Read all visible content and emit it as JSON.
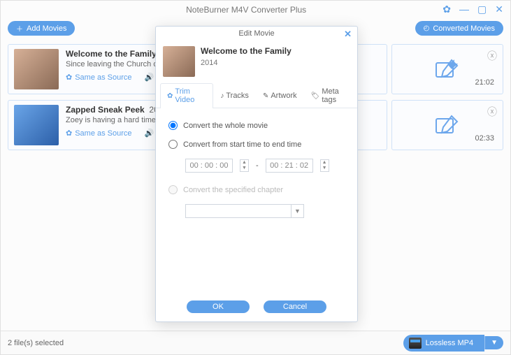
{
  "title": "NoteBurner M4V Converter Plus",
  "toolbar": {
    "add_label": "Add Movies",
    "converted_label": "Converted Movies"
  },
  "movies": [
    {
      "title": "Welcome to the Family",
      "desc": "Since leaving the Church of Sc",
      "source_label": "Same as Source",
      "duration": "21:02"
    },
    {
      "title": "Zapped Sneak Peek",
      "desc": "Zoey is having a hard time adj",
      "source_label": "Same as Source",
      "duration": "02:33"
    }
  ],
  "movie1_year_badge": "20",
  "footer": {
    "status": "2 file(s) selected",
    "format": "Lossless MP4"
  },
  "modal": {
    "title": "Edit Movie",
    "movie_title": "Welcome to the Family",
    "movie_year": "2014",
    "tabs": {
      "trim": "Trim Video",
      "tracks": "Tracks",
      "artwork": "Artwork",
      "meta": "Meta tags"
    },
    "opts": {
      "whole": "Convert the whole movie",
      "range": "Convert from start time to end time",
      "chapter": "Convert the specified chapter"
    },
    "time_start": "00 : 00 : 00",
    "time_sep": "-",
    "time_end": "00 : 21 : 02",
    "ok": "OK",
    "cancel": "Cancel"
  }
}
